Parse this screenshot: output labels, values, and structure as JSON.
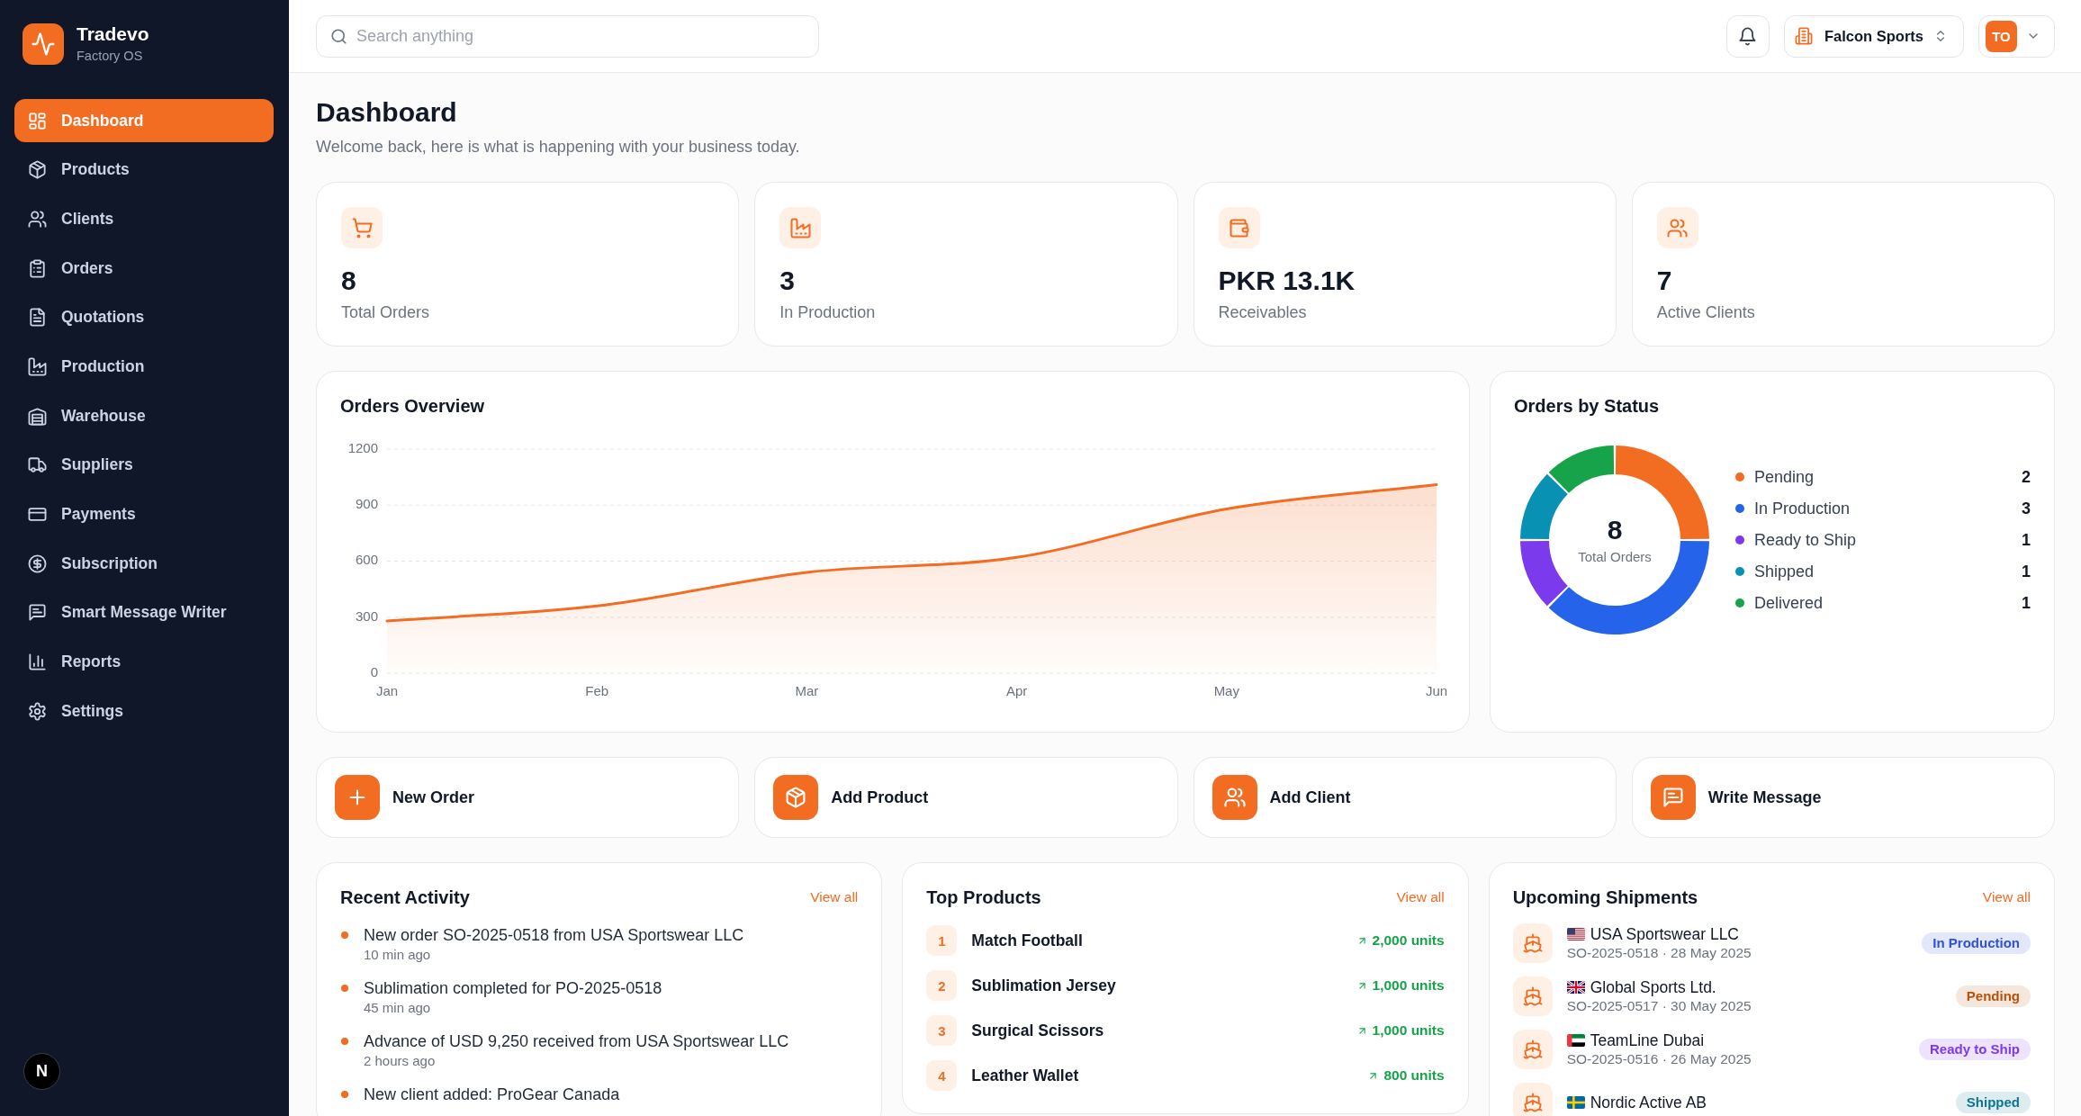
{
  "sidebar": {
    "brand": {
      "name": "Tradevo",
      "tagline": "Factory OS"
    },
    "items": [
      {
        "label": "Dashboard",
        "selected": true
      },
      {
        "label": "Products",
        "selected": false
      },
      {
        "label": "Clients",
        "selected": false
      },
      {
        "label": "Orders",
        "selected": false
      },
      {
        "label": "Quotations",
        "selected": false
      },
      {
        "label": "Production",
        "selected": false
      },
      {
        "label": "Warehouse",
        "selected": false
      },
      {
        "label": "Suppliers",
        "selected": false
      },
      {
        "label": "Payments",
        "selected": false
      },
      {
        "label": "Subscription",
        "selected": false
      },
      {
        "label": "Smart Message Writer",
        "selected": false
      },
      {
        "label": "Reports",
        "selected": false
      },
      {
        "label": "Settings",
        "selected": false
      }
    ],
    "dev_badge": "N"
  },
  "top_bar": {
    "search": {
      "placeholder": "Search anything"
    },
    "company": "Falcon Sports",
    "avatar": "TO"
  },
  "page": {
    "title": "Dashboard",
    "subtitle": "Welcome back, here is what is happening with your business today."
  },
  "stats": [
    {
      "value": "8",
      "label": "Total Orders"
    },
    {
      "value": "3",
      "label": "In Production"
    },
    {
      "value": "PKR 13.1K",
      "label": "Receivables"
    },
    {
      "value": "7",
      "label": "Active Clients"
    }
  ],
  "orders_overview": {
    "title": "Orders Overview",
    "chart_data": {
      "type": "area",
      "categories": [
        "Jan",
        "Feb",
        "Mar",
        "Apr",
        "May",
        "Jun"
      ],
      "series": [
        {
          "color": "#f26c22",
          "values": [
            280,
            360,
            540,
            620,
            880,
            1010
          ]
        }
      ],
      "ylim": [
        0,
        1200
      ],
      "yticks": [
        0,
        300,
        600,
        900,
        1200
      ],
      "grid": true
    }
  },
  "orders_by_status": {
    "title": "Orders by Status",
    "center_value": "8",
    "center_label": "Total Orders",
    "chart_data": {
      "type": "donut",
      "categories": [
        "Pending",
        "In Production",
        "Ready to Ship",
        "Shipped",
        "Delivered"
      ],
      "values": [
        25,
        37.5,
        12.5,
        12.5,
        12.5
      ]
    },
    "legend": [
      {
        "count": "2",
        "color": "#f26c22"
      },
      {
        "count": "3",
        "color": "#2563eb"
      },
      {
        "count": "1",
        "color": "#7c3aed"
      },
      {
        "count": "1",
        "color": "#0891b2"
      },
      {
        "count": "1",
        "color": "#16a34a"
      }
    ]
  },
  "quick_actions": [
    {
      "label": "New Order"
    },
    {
      "label": "Add Product"
    },
    {
      "label": "Add Client"
    },
    {
      "label": "Write Message"
    }
  ],
  "recent_activity": {
    "title": "Recent Activity",
    "link": "View all",
    "items": [
      {
        "text": "New order SO-2025-0518 from USA Sportswear LLC",
        "time": "10 min ago"
      },
      {
        "text": "Sublimation completed for PO-2025-0518",
        "time": "45 min ago"
      },
      {
        "text": "Advance of USD 9,250 received from USA Sportswear LLC",
        "time": "2 hours ago"
      },
      {
        "text": "New client added: ProGear Canada"
      }
    ]
  },
  "top_products": {
    "title": "Top Products",
    "link": "View all",
    "items": [
      {
        "rank": "1",
        "name": "Match Football",
        "units": "2,000 units"
      },
      {
        "rank": "2",
        "name": "Sublimation Jersey",
        "units": "1,000 units"
      },
      {
        "rank": "3",
        "name": "Surgical Scissors",
        "units": "1,000 units"
      },
      {
        "rank": "4",
        "name": "Leather Wallet",
        "units": "800 units"
      }
    ]
  },
  "upcoming_shipments": {
    "title": "Upcoming Shipments",
    "link": "View all",
    "items": [
      {
        "client": "USA Sportswear LLC",
        "ref": "SO-2025-0518 · 28 May 2025",
        "status": "In Production",
        "color": "#3151d9"
      },
      {
        "client": "Global Sports Ltd.",
        "ref": "SO-2025-0517 · 30 May 2025",
        "status": "Pending",
        "color": "#b45309"
      },
      {
        "client": "TeamLine Dubai",
        "ref": "SO-2025-0516 · 26 May 2025",
        "status": "Ready to Ship",
        "color": "#7c3aed"
      },
      {
        "client": "Nordic Active AB",
        "status": "Shipped",
        "color": "#0e7490"
      }
    ]
  }
}
